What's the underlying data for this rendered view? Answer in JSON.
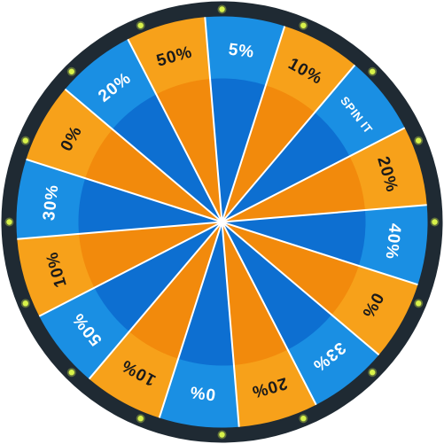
{
  "wheel": {
    "segments": [
      {
        "label": "5%",
        "color": "blue"
      },
      {
        "label": "10%",
        "color": "orange"
      },
      {
        "label": "SPIN IT",
        "color": "blue"
      },
      {
        "label": "20%",
        "color": "orange"
      },
      {
        "label": "40%",
        "color": "blue"
      },
      {
        "label": "0%",
        "color": "orange"
      },
      {
        "label": "33%",
        "color": "blue"
      },
      {
        "label": "20%",
        "color": "orange"
      },
      {
        "label": "0%",
        "color": "blue"
      },
      {
        "label": "10%",
        "color": "orange"
      },
      {
        "label": "50%",
        "color": "blue"
      },
      {
        "label": "10%",
        "color": "orange"
      },
      {
        "label": "30%",
        "color": "blue"
      },
      {
        "label": "0%",
        "color": "orange"
      },
      {
        "label": "20%",
        "color": "blue"
      },
      {
        "label": "50%",
        "color": "orange"
      }
    ],
    "light_count": 16,
    "colors": {
      "blue_outer": "#1a8fe3",
      "blue_inner": "#0d6fd1",
      "orange_outer": "#f7a11a",
      "orange_inner": "#f28a0c",
      "blue_text": "#ffffff",
      "orange_text": "#1a1a1a",
      "rim": "#1f2a33",
      "light": "#d8f24a",
      "divider": "#ffffff"
    }
  }
}
